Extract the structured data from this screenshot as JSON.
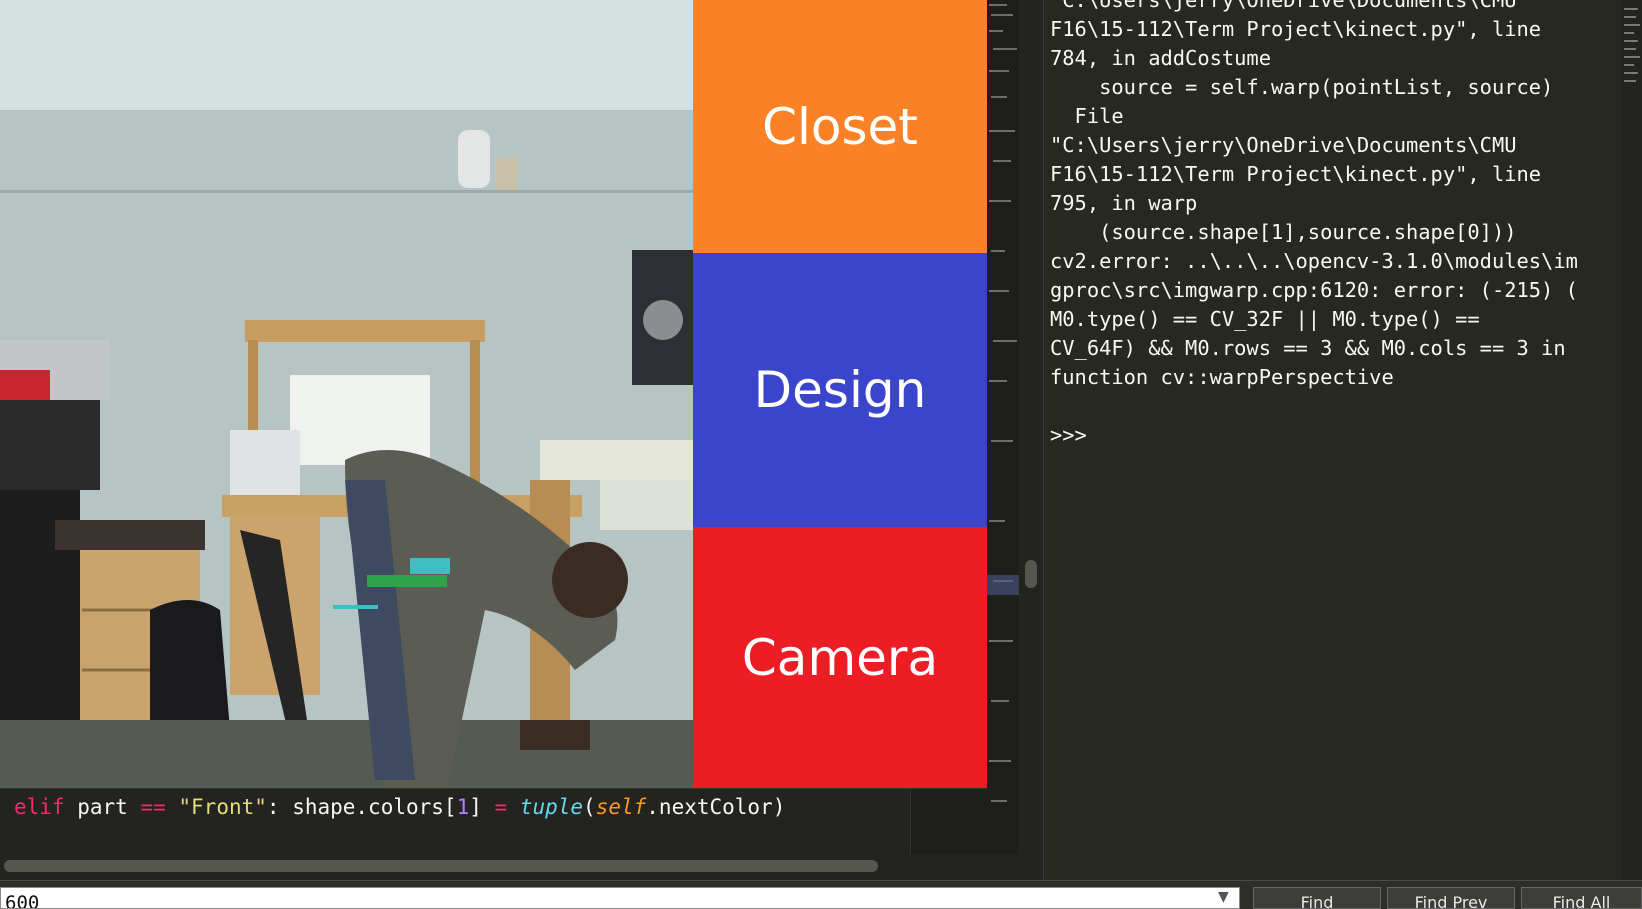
{
  "menu": {
    "closet": {
      "label": "Closet",
      "color": "#fb8126"
    },
    "design": {
      "label": "Design",
      "color": "#3b45cc"
    },
    "camera": {
      "label": "Camera",
      "color": "#ec1d25"
    }
  },
  "console": {
    "lines": [
      "\"C:\\Users\\jerry\\OneDrive\\Documents\\CMU",
      "F16\\15-112\\Term Project\\kinect.py\", line",
      "784, in addCostume",
      "    source = self.warp(pointList, source)",
      "  File",
      "\"C:\\Users\\jerry\\OneDrive\\Documents\\CMU",
      "F16\\15-112\\Term Project\\kinect.py\", line",
      "795, in warp",
      "    (source.shape[1],source.shape[0]))",
      "cv2.error: ..\\..\\..\\opencv-3.1.0\\modules\\im",
      "gproc\\src\\imgwarp.cpp:6120: error: (-215) (",
      "M0.type() == CV_32F || M0.type() ==",
      "CV_64F) && M0.rows == 3 && M0.cols == 3 in",
      "function cv::warpPerspective",
      "",
      ">>>"
    ]
  },
  "editor": {
    "code": {
      "kw_elif": "elif",
      "var_part": " part ",
      "op_eq": "==",
      "str_front": "\"Front\"",
      "mid": ": shape.colors[",
      "num_1": "1",
      "close": "] ",
      "op_assign": "=",
      "fn_tuple": "tuple",
      "paren_open": "(",
      "self_kw": "self",
      "attr": ".nextColor)"
    }
  },
  "findbar": {
    "input_value": "600",
    "find": "Find",
    "find_prev": "Find Prev",
    "find_all": "Find All"
  },
  "colors": {
    "editor_bg": "#272822",
    "keyword": "#f92672",
    "string": "#e6db74",
    "number": "#ae81ff",
    "builtin": "#66d9ef",
    "self": "#fd971f"
  },
  "icons": {
    "find_dropdown": "chevron-down-icon"
  }
}
